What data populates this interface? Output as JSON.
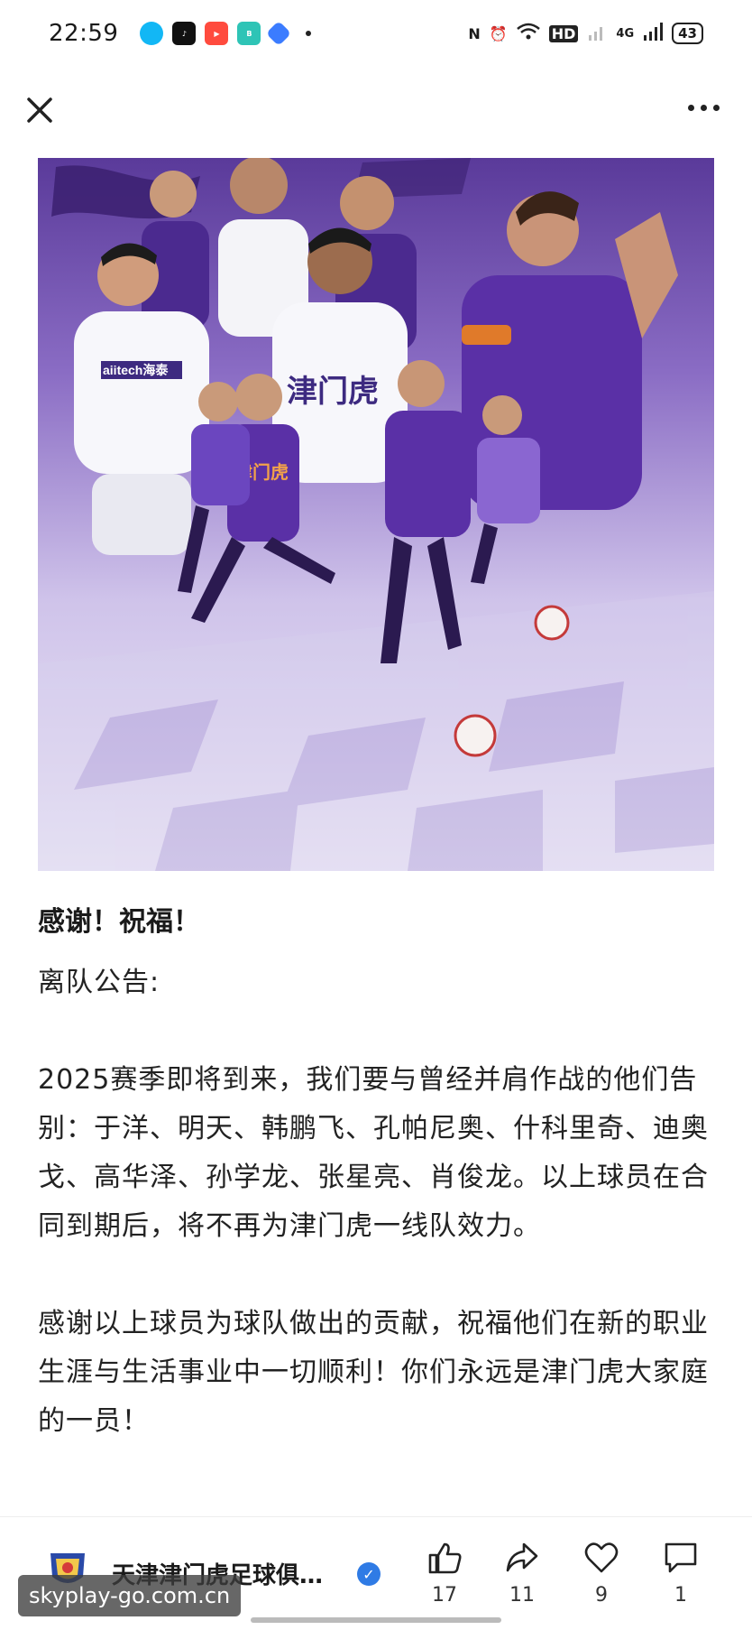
{
  "status": {
    "time": "22:59",
    "app_icons": [
      {
        "name": "qq-icon",
        "color": "#12b7f5"
      },
      {
        "name": "tiktok-icon",
        "color": "#111111"
      },
      {
        "name": "video-app-icon",
        "color": "#ff4b3e"
      },
      {
        "name": "boss-app-icon",
        "color": "#2ec4b6",
        "text": "BOSS\n直聘"
      },
      {
        "name": "blue-app-icon",
        "color": "#3b7cff"
      }
    ],
    "signal_label": "HD",
    "network_label": "4G",
    "battery": "43"
  },
  "article": {
    "title": "感谢！祝福！",
    "subtitle": "离队公告:",
    "paragraph1": "2025赛季即将到来，我们要与曾经并肩作战的他们告别：于洋、明天、韩鹏飞、孔帕尼奥、什科里奇、迪奥戈、高华泽、孙学龙、张星亮、肖俊龙。以上球员在合同到期后，将不再为津门虎一线队效力。",
    "paragraph2": "感谢以上球员为球队做出的贡献，祝福他们在新的职业生涯与生活事业中一切顺利！你们永远是津门虎大家庭的一员！"
  },
  "hero": {
    "jersey_text_1": "津门虎",
    "jersey_text_2": "津门虎",
    "sponsor": "aiitech海泰"
  },
  "author": {
    "name": "天津津门虎足球俱…"
  },
  "actions": {
    "likes": "17",
    "shares": "11",
    "favorites": "9",
    "comments": "1"
  },
  "watermark": "skyplay-go.com.cn",
  "colors": {
    "purple": "#5a3a9a",
    "verified_blue": "#2f7be5"
  }
}
